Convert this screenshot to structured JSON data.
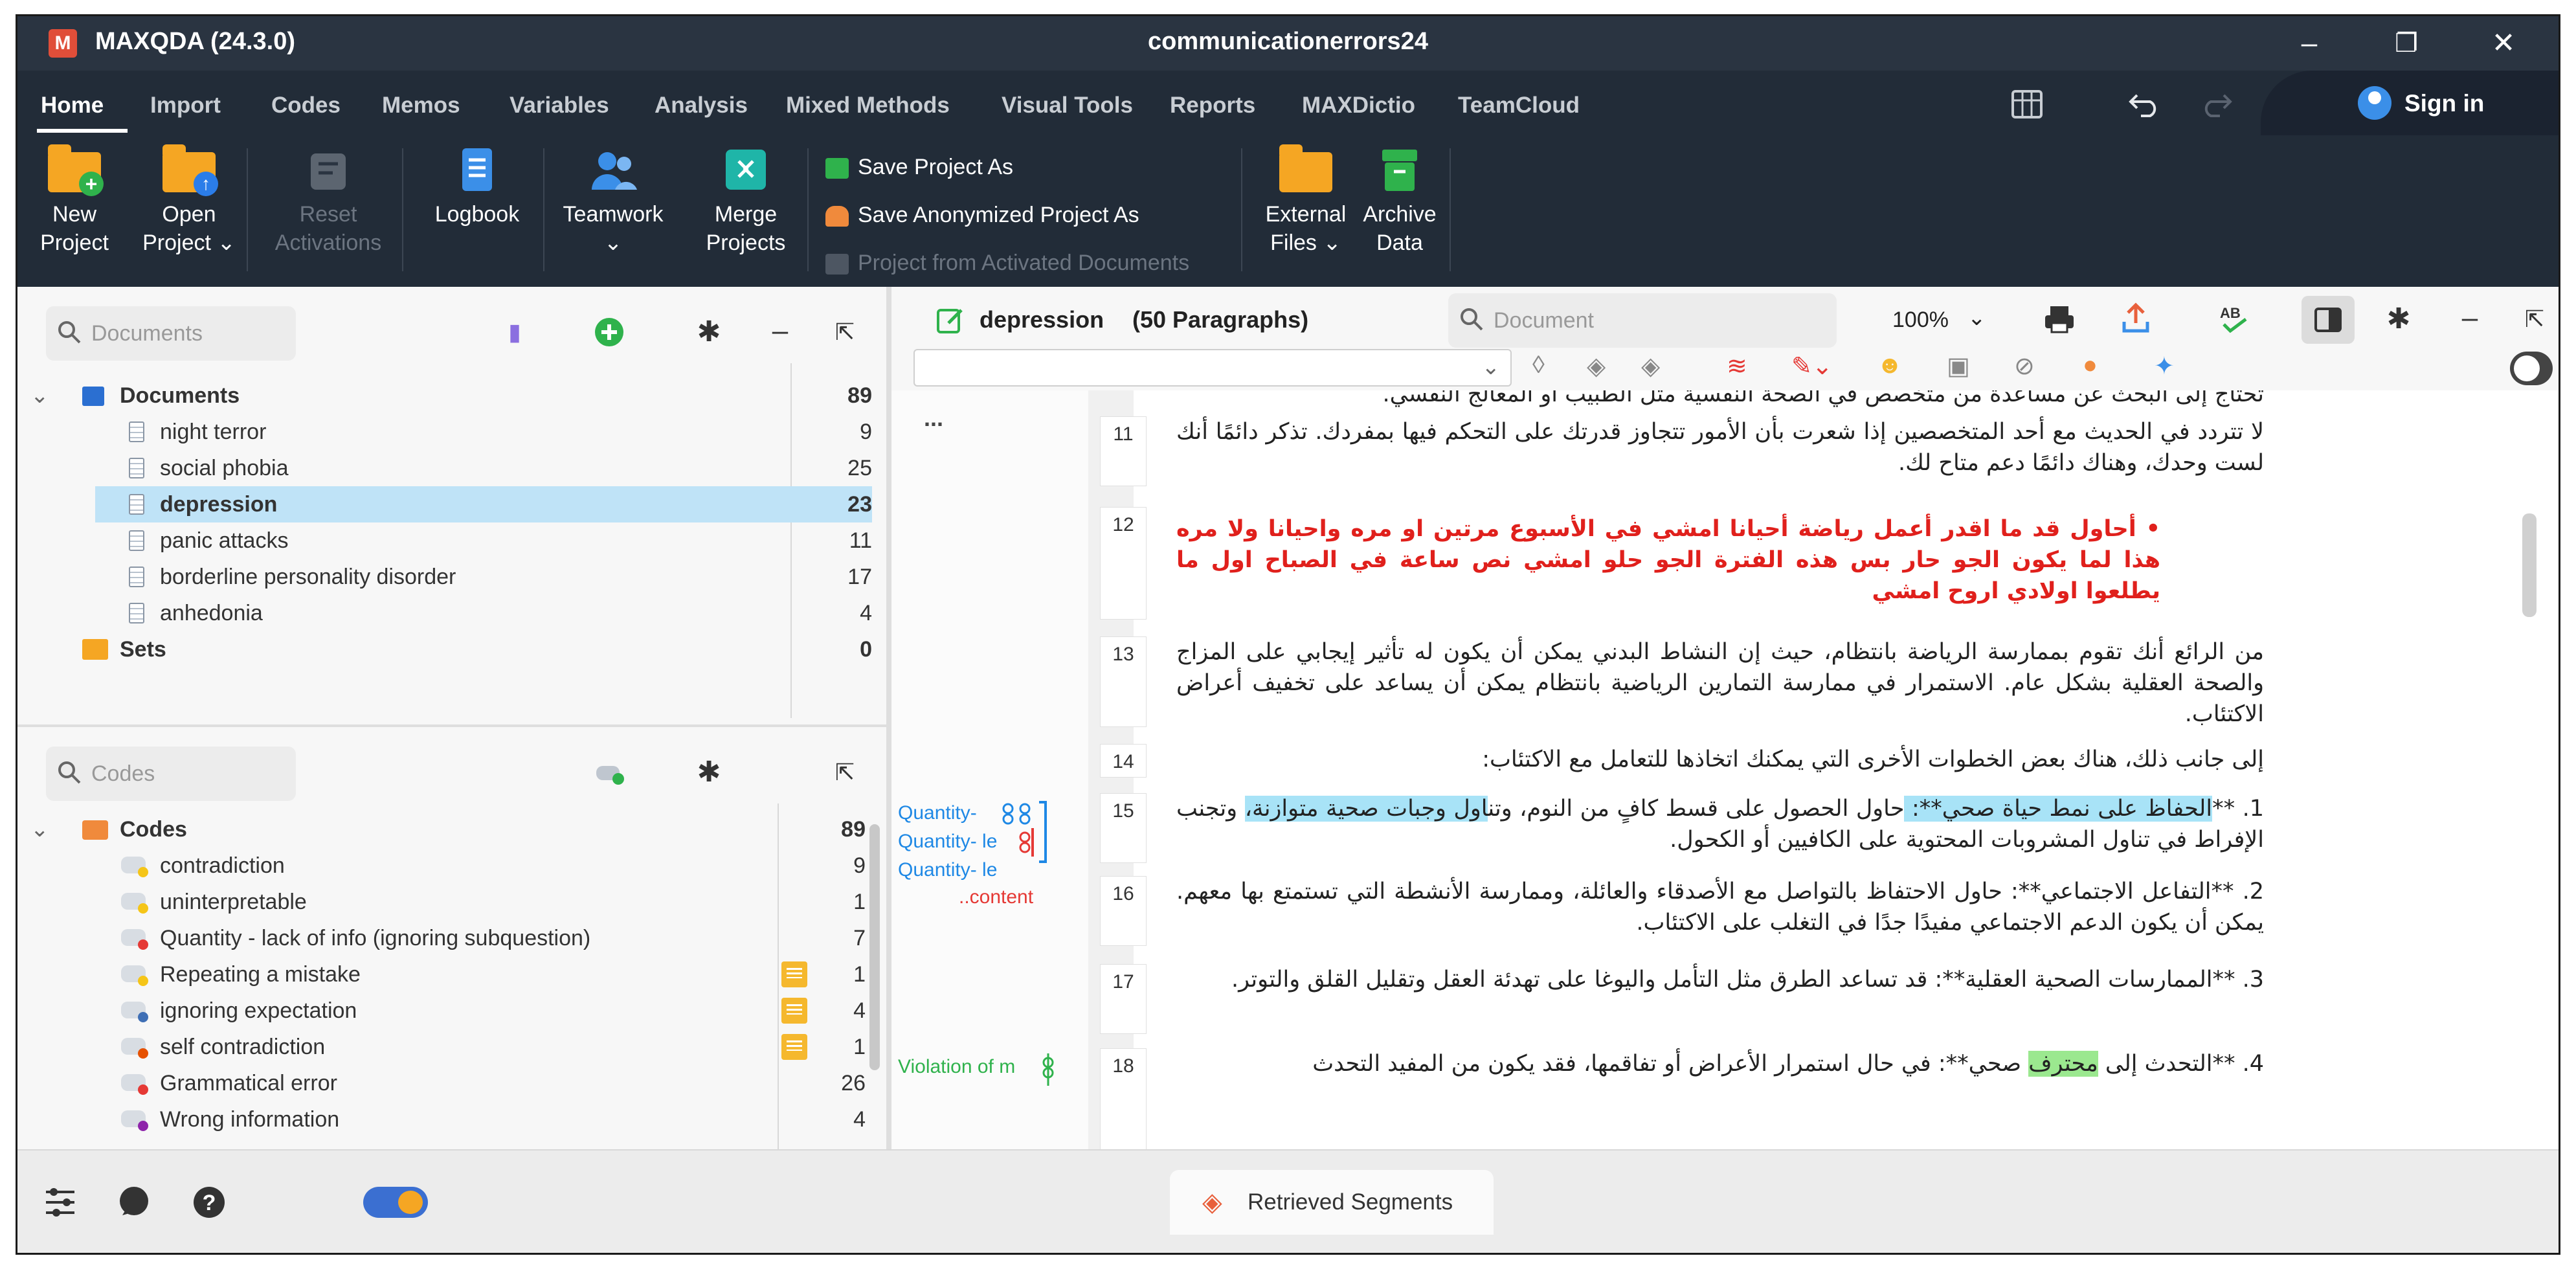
{
  "app": {
    "logo": "M",
    "name": "MAXQDA (24.3.0)",
    "project": "communicationerrors24"
  },
  "window_controls": [
    "–",
    "❐",
    "✕"
  ],
  "menu": {
    "tabs": [
      "Home",
      "Import",
      "Codes",
      "Memos",
      "Variables",
      "Analysis",
      "Mixed Methods",
      "Visual Tools",
      "Reports",
      "MAXDictio",
      "TeamCloud"
    ],
    "active": "Home",
    "sign_in": "Sign in"
  },
  "ribbon": {
    "new_project": [
      "New",
      "Project"
    ],
    "open_project": [
      "Open",
      "Project ⌄"
    ],
    "reset_activations": [
      "Reset",
      "Activations"
    ],
    "logbook": "Logbook",
    "teamwork": [
      "Teamwork",
      "⌄"
    ],
    "merge_projects": [
      "Merge",
      "Projects"
    ],
    "save_project_as": "Save Project As",
    "save_anonymized": "Save Anonymized Project As",
    "project_from_activated": "Project from Activated Documents",
    "external_files": [
      "External",
      "Files ⌄"
    ],
    "archive_data": [
      "Archive",
      "Data"
    ]
  },
  "documents_pane": {
    "search_placeholder": "Documents",
    "root": {
      "label": "Documents",
      "count": "89"
    },
    "items": [
      {
        "label": "night terror",
        "count": "9"
      },
      {
        "label": "social phobia",
        "count": "25"
      },
      {
        "label": "depression",
        "count": "23",
        "selected": true
      },
      {
        "label": "panic attacks",
        "count": "11"
      },
      {
        "label": "borderline personality disorder",
        "count": "17"
      },
      {
        "label": "anhedonia",
        "count": "4"
      }
    ],
    "sets": {
      "label": "Sets",
      "count": "0"
    }
  },
  "codes_pane": {
    "search_placeholder": "Codes",
    "root": {
      "label": "Codes",
      "count": "89"
    },
    "items": [
      {
        "label": "contradiction",
        "count": "9",
        "dot": "#f5c518",
        "memo": false
      },
      {
        "label": "uninterpretable",
        "count": "1",
        "dot": "#f5c518",
        "memo": false
      },
      {
        "label": " Quantity - lack of info (ignoring subquestion)",
        "count": "7",
        "dot": "#e53935",
        "memo": false
      },
      {
        "label": "Repeating a mistake",
        "count": "1",
        "dot": "#f5c518",
        "memo": true
      },
      {
        "label": "ignoring expectation",
        "count": "4",
        "dot": "#3f6fb5",
        "memo": true
      },
      {
        "label": "self contradiction",
        "count": "1",
        "dot": "#e65100",
        "memo": true
      },
      {
        "label": "Grammatical error",
        "count": "26",
        "dot": "#e53935",
        "memo": false
      },
      {
        "label": "Wrong information",
        "count": "4",
        "dot": "#8e24aa",
        "memo": false
      }
    ]
  },
  "document_view": {
    "title": "depression",
    "paragraphs_label": "(50 Paragraphs)",
    "search_placeholder": "Document",
    "zoom": "100%",
    "ellipsis": "...",
    "top_cut_text": "تحتاج إلى البحث عن مساعدة من متخصص في الصحة النفسية مثل الطبيب أو المعالج النفسي.",
    "paragraphs": [
      {
        "num": "11",
        "text": "لا تتردد في الحديث مع أحد المتخصصين إذا شعرت بأن الأمور تتجاوز قدرتك على التحكم فيها بمفردك. تذكر دائمًا أنك لست وحدك، وهناك دائمًا دعم متاح لك."
      },
      {
        "num": "12",
        "text": "• أحاول قد ما اقدر أعمل رياضة أحيانا امشي في الأسبوع مرتين او مره واحيانا ولا مره هذا لما يكون الجو حار بس هذه الفترة الجو حلو امشي نص ساعة في الصباح اول ما يطلعوا اولادي اروح امشي"
      },
      {
        "num": "13",
        "text": "من الرائع أنك تقوم بممارسة الرياضة بانتظام، حيث إن النشاط البدني يمكن أن يكون له تأثير إيجابي على المزاج والصحة العقلية بشكل عام. الاستمرار في ممارسة التمارين الرياضية بانتظام يمكن أن يساعد على تخفيف أعراض الاكتئاب."
      },
      {
        "num": "14",
        "text": "إلى جانب ذلك، هناك بعض الخطوات الأخرى التي يمكنك اتخاذها للتعامل مع الاكتئاب:"
      },
      {
        "num": "15",
        "pre": "1. **",
        "hl1": "الحفاظ على نمط حياة صحي**: ",
        "mid": "حاول الحصول على قسط كافٍ من النوم، وتن",
        "hl2": "اول وجبات صحية متوازنة،",
        "post": " وتجنب الإفراط في تناول المشروبات المحتوية على الكافيين أو الكحول."
      },
      {
        "num": "16",
        "text": "2. **التفاعل الاجتماعي**: حاول الاحتفاظ بالتواصل مع الأصدقاء والعائلة، وممارسة الأنشطة التي تستمتع بها معهم. يمكن أن يكون الدعم الاجتماعي مفيدًا جدًا في التغلب على الاكتئاب."
      },
      {
        "num": "17",
        "text": "3. **الممارسات الصحية العقلية**: قد تساعد الطرق مثل التأمل واليوغا على تهدئة العقل وتقليل القلق والتوتر."
      },
      {
        "num": "18",
        "pre": "4. **التحدث إلى ",
        "hl": "محترف",
        "post": " صحي**: في حال استمرار الأعراض أو تفاقمها، فقد يكون من المفيد التحدث"
      }
    ],
    "code_labels": {
      "q1": "Quantity-",
      "q2": "Quantity- le",
      "q3": "Quantity- le",
      "content": "..content",
      "violation": "Violation of m"
    }
  },
  "bottom": {
    "retrieved_segments": "Retrieved Segments"
  },
  "colors": {
    "accent_blue": "#a8e3f7",
    "accent_green": "#9be88f",
    "selection": "#bfe3f7",
    "chrome_dark": "#222c38"
  }
}
